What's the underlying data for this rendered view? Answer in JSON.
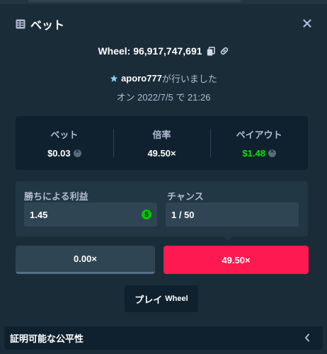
{
  "modal": {
    "title": "ベット",
    "close_icon": "close-icon",
    "header_icon": "bet-slip-icon"
  },
  "bet": {
    "game": "Wheel",
    "id": "96,917,747,691",
    "wheel_text": "Wheel: 96,917,747,691",
    "copy_icon": "copy-icon",
    "link_icon": "link-icon",
    "user_icon": "star-icon",
    "username": "aporo777",
    "placed_suffix": "が行いました",
    "date_text": "オン 2022/7/5 で 21:26"
  },
  "stats": {
    "bet_label": "ベット",
    "bet_value": "$0.03",
    "multiplier_label": "倍率",
    "multiplier_value": "49.50×",
    "payout_label": "ペイアウト",
    "payout_value": "$1.48",
    "currency_icon": "currency-coin-icon"
  },
  "form": {
    "profit_label": "勝ちによる利益",
    "profit_value": "1.45",
    "chance_label": "チャンス",
    "chance_value": "1 / 50",
    "dollar_icon": "dollar-coin-icon"
  },
  "segments": {
    "left": "0.00×",
    "right": "49.50×"
  },
  "play": {
    "label": "プレイ",
    "game": "Wheel"
  },
  "footer": {
    "label": "証明可能な公平性",
    "chevron_icon": "chevron-left-icon"
  },
  "colors": {
    "background": "#1a2c38",
    "panel": "#0f212e",
    "input": "#2f4553",
    "accent_red": "#fe1951",
    "accent_green": "#00e701",
    "muted_text": "#b1bad3"
  }
}
